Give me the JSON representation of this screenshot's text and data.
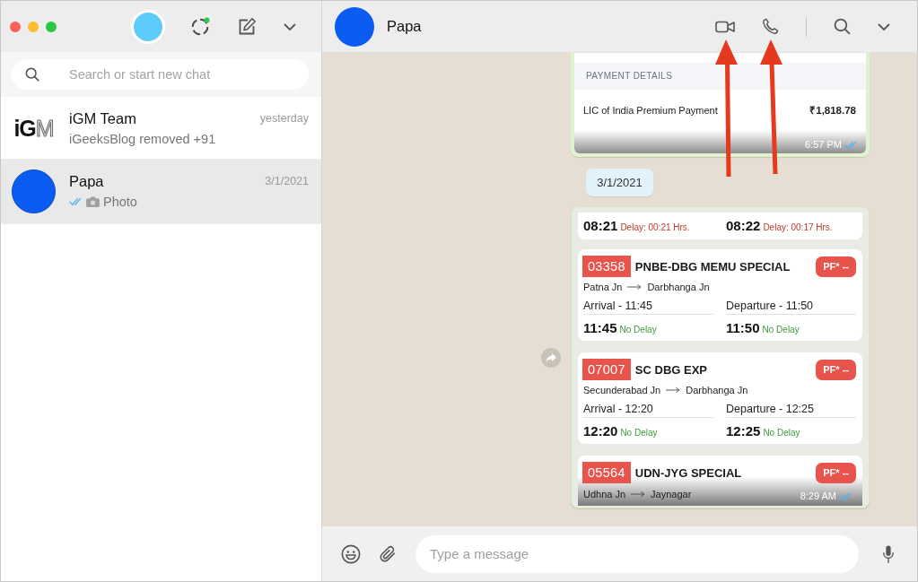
{
  "sidebar": {
    "search": {
      "placeholder": "Search or start new chat"
    },
    "chats": [
      {
        "name": "iGM Team",
        "time": "yesterday",
        "preview": "iGeeksBlog removed +91",
        "photo": false,
        "selected": false,
        "avatar": {
          "kind": "logo",
          "text": "**iG**M"
        }
      },
      {
        "name": "Papa",
        "time": "3/1/2021",
        "preview": "Photo",
        "photo": true,
        "read": true,
        "selected": true,
        "avatar": {
          "kind": "photo"
        }
      }
    ]
  },
  "chat": {
    "name": "Papa"
  },
  "messages": [
    {
      "kind": "payment",
      "section": "PAYMENT DETAILS",
      "item": "LIC of India Premium Payment",
      "amount": "₹1,818.78",
      "time": "6:57 PM",
      "read": true
    },
    {
      "kind": "date",
      "text": "3/1/2021"
    },
    {
      "kind": "trains",
      "forward": true,
      "time": "8:29 AM",
      "read": true,
      "cards": [
        {
          "columns": [
            {
              "time": "08:21",
              "note": "Delay: 00:21 Hrs.",
              "delayed": true
            },
            {
              "time": "08:22",
              "note": "Delay: 00:17 Hrs.",
              "delayed": true
            }
          ]
        },
        {
          "number": "03358",
          "name": "PNBE-DBG MEMU SPECIAL",
          "platform": "PF* --",
          "from": "Patna Jn",
          "to": "Darbhanga Jn",
          "columns": [
            {
              "label": "Arrival - 11:45",
              "time": "11:45",
              "note": "No Delay",
              "delayed": false
            },
            {
              "label": "Departure - 11:50",
              "time": "11:50",
              "note": "No Delay",
              "delayed": false
            }
          ]
        },
        {
          "number": "07007",
          "name": "SC DBG EXP",
          "platform": "PF* --",
          "from": "Secunderabad Jn",
          "to": "Darbhanga Jn",
          "columns": [
            {
              "label": "Arrival - 12:20",
              "time": "12:20",
              "note": "No Delay",
              "delayed": false
            },
            {
              "label": "Departure - 12:25",
              "time": "12:25",
              "note": "No Delay",
              "delayed": false
            }
          ]
        },
        {
          "number": "05564",
          "name": "UDN-JYG SPECIAL",
          "platform": "PF* --",
          "from": "Udhna Jn",
          "to": "Jaynagar"
        }
      ]
    }
  ],
  "composer": {
    "placeholder": "Type a message"
  }
}
